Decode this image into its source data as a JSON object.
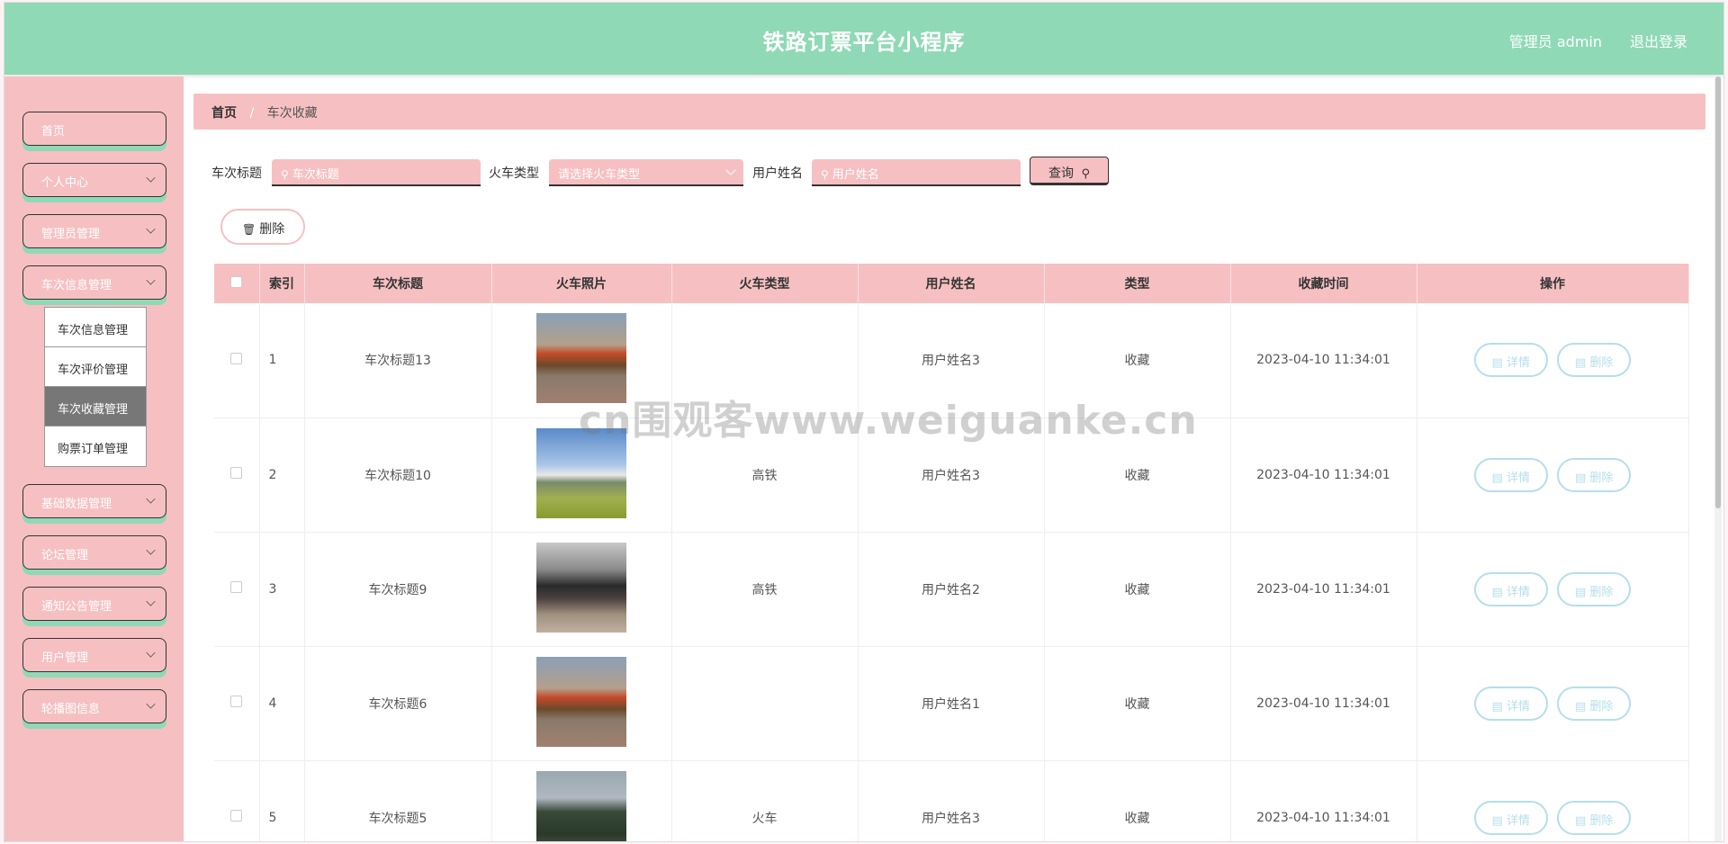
{
  "header": {
    "title": "铁路订票平台小程序",
    "admin": "管理员 admin",
    "logout": "退出登录"
  },
  "sidebar": {
    "items": [
      {
        "label": "首页"
      },
      {
        "label": "个人中心"
      },
      {
        "label": "管理员管理"
      },
      {
        "label": "车次信息管理"
      },
      {
        "label": "基础数据管理"
      },
      {
        "label": "论坛管理"
      },
      {
        "label": "通知公告管理"
      },
      {
        "label": "用户管理"
      },
      {
        "label": "轮播图信息"
      }
    ],
    "submenu": [
      {
        "label": "车次信息管理"
      },
      {
        "label": "车次评价管理"
      },
      {
        "label": "车次收藏管理"
      },
      {
        "label": "购票订单管理"
      }
    ]
  },
  "breadcrumb": {
    "home": "首页",
    "separator": "/",
    "current": "车次收藏"
  },
  "search": {
    "title_label": "车次标题",
    "title_placeholder": "车次标题",
    "type_label": "火车类型",
    "type_placeholder": "请选择火车类型",
    "user_label": "用户姓名",
    "user_placeholder": "用户姓名",
    "query_label": "查询"
  },
  "toolbar": {
    "delete_label": "删除"
  },
  "table": {
    "columns": [
      "",
      "索引",
      "车次标题",
      "火车照片",
      "火车类型",
      "用户姓名",
      "类型",
      "收藏时间",
      "操作"
    ],
    "rows": [
      {
        "index": "1",
        "title": "车次标题13",
        "train_type": "",
        "user": "用户姓名3",
        "kind": "收藏",
        "time": "2023-04-10 11:34:01"
      },
      {
        "index": "2",
        "title": "车次标题10",
        "train_type": "高铁",
        "user": "用户姓名3",
        "kind": "收藏",
        "time": "2023-04-10 11:34:01"
      },
      {
        "index": "3",
        "title": "车次标题9",
        "train_type": "高铁",
        "user": "用户姓名2",
        "kind": "收藏",
        "time": "2023-04-10 11:34:01"
      },
      {
        "index": "4",
        "title": "车次标题6",
        "train_type": "",
        "user": "用户姓名1",
        "kind": "收藏",
        "time": "2023-04-10 11:34:01"
      },
      {
        "index": "5",
        "title": "车次标题5",
        "train_type": "火车",
        "user": "用户姓名3",
        "kind": "收藏",
        "time": "2023-04-10 11:34:01"
      }
    ],
    "detail_label": "详情",
    "delete_label": "删除"
  },
  "watermark": "cn围观客www.weiguanke.cn",
  "colors": {
    "header": "#8fd9b6",
    "sidebar": "#f6c0c2",
    "accent_pink": "#f6c0c2",
    "op_button": "#b5deea"
  }
}
